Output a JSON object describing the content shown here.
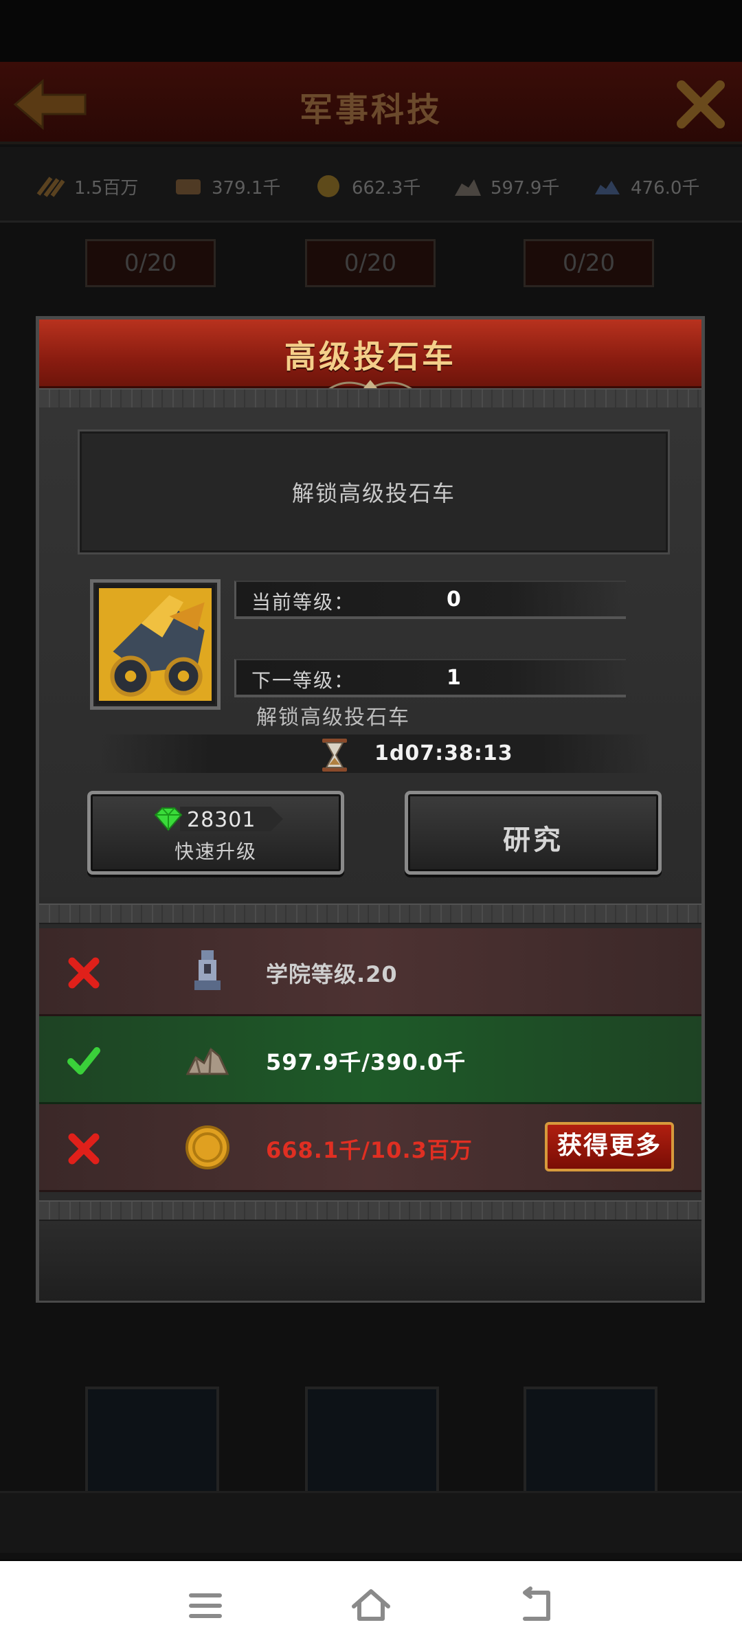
{
  "background": {
    "title": "军事科技",
    "resources": [
      {
        "icon": "wood-icon",
        "value": "1.5百万"
      },
      {
        "icon": "food-icon",
        "value": "379.1千"
      },
      {
        "icon": "gold-coin-icon",
        "value": "662.3千"
      },
      {
        "icon": "stone-icon",
        "value": "597.9千"
      },
      {
        "icon": "ore-icon",
        "value": "476.0千"
      }
    ],
    "cells": [
      "0/20",
      "0/20",
      "0/20"
    ]
  },
  "dialog": {
    "title": "高级投石车",
    "description": "解锁高级投石车",
    "current_level_label": "当前等级：",
    "current_level_value": "0",
    "next_level_label": "下一等级：",
    "next_level_value": "1",
    "next_level_effect": "解锁高级投石车",
    "timer": "1d07:38:13",
    "quick_upgrade": {
      "gem_cost": "28301",
      "label": "快速升级"
    },
    "research_label": "研究",
    "requirements": [
      {
        "status": "unmet",
        "icon": "academy-icon",
        "text": "学院等级.20",
        "text_color": "#cfcfcf"
      },
      {
        "status": "met",
        "icon": "stone-icon",
        "text": "597.9千/390.0千",
        "text_color": "#ffffff"
      },
      {
        "status": "unmet",
        "icon": "gold-coin-icon",
        "text": "668.1千/10.3百万",
        "text_color": "#e02f22",
        "action_label": "获得更多"
      }
    ]
  },
  "colors": {
    "header_red": "#a8281a",
    "title_gold": "#f4cf8a",
    "met_green": "#1e5a28",
    "unmet_red": "#4d3232"
  }
}
